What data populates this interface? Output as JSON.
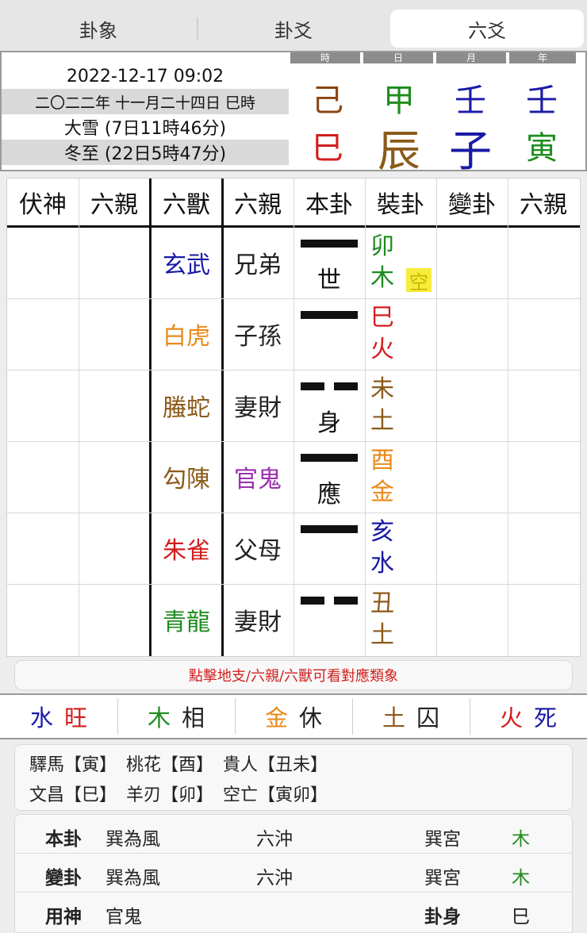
{
  "tabs": [
    {
      "label": "卦象"
    },
    {
      "label": "卦爻"
    },
    {
      "label": "六爻"
    }
  ],
  "header": {
    "datetime": "2022-12-17 09:02",
    "lunar": "二〇二二年 十一月二十四日 巳時",
    "solar_term_1": "大雪 (7日11時46分)",
    "solar_term_2": "冬至 (22日5時47分)",
    "pillar_heads": [
      "時",
      "日",
      "月",
      "年"
    ],
    "stems": [
      {
        "char": "己",
        "color": "#8b4513"
      },
      {
        "char": "甲",
        "color": "#1e8c1e"
      },
      {
        "char": "壬",
        "color": "#1a1aa6"
      },
      {
        "char": "壬",
        "color": "#1a1aa6"
      }
    ],
    "branches": [
      {
        "char": "巳",
        "color": "#d21e1e"
      },
      {
        "char": "辰",
        "color": "#8b5a1a"
      },
      {
        "char": "子",
        "color": "#1a1aa6"
      },
      {
        "char": "寅",
        "color": "#1e8c1e"
      }
    ]
  },
  "table": {
    "headers": [
      "伏神",
      "六親",
      "六獸",
      "六親",
      "本卦",
      "裝卦",
      "變卦",
      "六親"
    ],
    "rows": [
      {
        "beast": "玄武",
        "beast_color": "#1a1aa6",
        "relative": "兄弟",
        "relative_color": "#222222",
        "yao": "yang",
        "mark": "世",
        "zhi": "卯",
        "wx": "木",
        "zhi_color": "#1e8c1e",
        "kong": "空"
      },
      {
        "beast": "白虎",
        "beast_color": "#e88a1a",
        "relative": "子孫",
        "relative_color": "#222222",
        "yao": "yang",
        "mark": "",
        "zhi": "巳",
        "wx": "火",
        "zhi_color": "#d21e1e",
        "kong": ""
      },
      {
        "beast": "螣蛇",
        "beast_color": "#8b5a1a",
        "relative": "妻財",
        "relative_color": "#222222",
        "yao": "yin",
        "mark": "身",
        "zhi": "未",
        "wx": "土",
        "zhi_color": "#8b5a1a",
        "kong": ""
      },
      {
        "beast": "勾陳",
        "beast_color": "#8b5a1a",
        "relative": "官鬼",
        "relative_color": "#9a30b0",
        "yao": "yang",
        "mark": "應",
        "zhi": "酉",
        "wx": "金",
        "zhi_color": "#e88a1a",
        "kong": ""
      },
      {
        "beast": "朱雀",
        "beast_color": "#d21e1e",
        "relative": "父母",
        "relative_color": "#222222",
        "yao": "yang",
        "mark": "",
        "zhi": "亥",
        "wx": "水",
        "zhi_color": "#1a1aa6",
        "kong": ""
      },
      {
        "beast": "青龍",
        "beast_color": "#1e8c1e",
        "relative": "妻財",
        "relative_color": "#222222",
        "yao": "yin",
        "mark": "",
        "zhi": "丑",
        "wx": "土",
        "zhi_color": "#8b5a1a",
        "kong": ""
      }
    ]
  },
  "tip": "點擊地支/六親/六獸可看對應類象",
  "wuxing": [
    {
      "el": "水",
      "el_color": "#1a1aa6",
      "state": "旺",
      "state_color": "#d21e1e"
    },
    {
      "el": "木",
      "el_color": "#1e8c1e",
      "state": "相",
      "state_color": "#222222"
    },
    {
      "el": "金",
      "el_color": "#e88a1a",
      "state": "休",
      "state_color": "#222222"
    },
    {
      "el": "土",
      "el_color": "#8b5a1a",
      "state": "囚",
      "state_color": "#222222"
    },
    {
      "el": "火",
      "el_color": "#d21e1e",
      "state": "死",
      "state_color": "#1a1aa6"
    }
  ],
  "shensha": {
    "row1": [
      "驛馬【寅】",
      "桃花【酉】",
      "貴人【丑未】"
    ],
    "row2": [
      "文昌【巳】",
      "羊刃【卯】",
      "空亡【寅卯】"
    ]
  },
  "info": {
    "rows": [
      {
        "label": "本卦",
        "name": "巽為風",
        "type": "六沖",
        "palace": "巽宮",
        "element": "木",
        "element_color": "#1e8c1e"
      },
      {
        "label": "變卦",
        "name": "巽為風",
        "type": "六沖",
        "palace": "巽宮",
        "element": "木",
        "element_color": "#1e8c1e"
      }
    ],
    "use_god_label": "用神",
    "use_god": "官鬼",
    "gua_shen_label": "卦身",
    "gua_shen": "巳"
  }
}
